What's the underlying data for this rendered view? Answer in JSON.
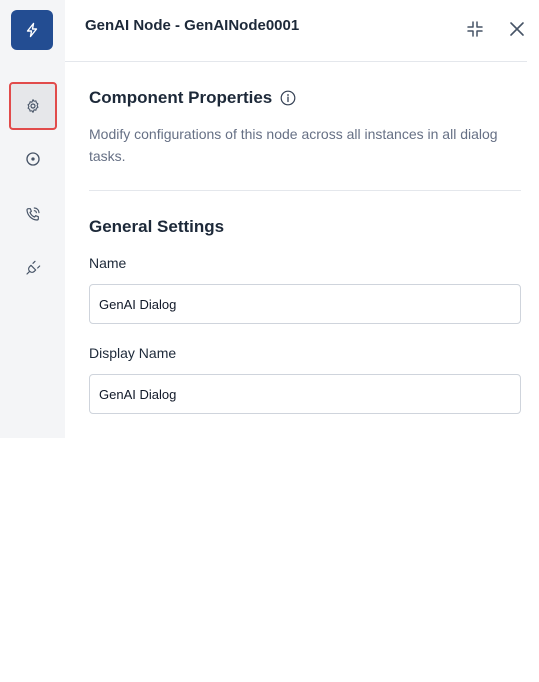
{
  "header": {
    "title": "GenAI Node - GenAINode0001"
  },
  "sidebar": {
    "items": [
      {
        "name": "component-properties",
        "icon": "gear-icon",
        "active": true
      },
      {
        "name": "instance-properties",
        "icon": "target-icon",
        "active": false
      },
      {
        "name": "voice-call-properties",
        "icon": "phone-call-icon",
        "active": false
      },
      {
        "name": "connections",
        "icon": "plug-icon",
        "active": false
      }
    ]
  },
  "main": {
    "section_title": "Component Properties",
    "description": "Modify configurations of this node across all instances in all dialog tasks.",
    "general_settings_title": "General Settings",
    "name_label": "Name",
    "name_value": "GenAI Dialog",
    "display_name_label": "Display Name",
    "display_name_value": "GenAI Dialog"
  },
  "colors": {
    "brand": "#234d92",
    "active_outline": "#e14b4b",
    "rail_bg": "#f4f5f7"
  }
}
